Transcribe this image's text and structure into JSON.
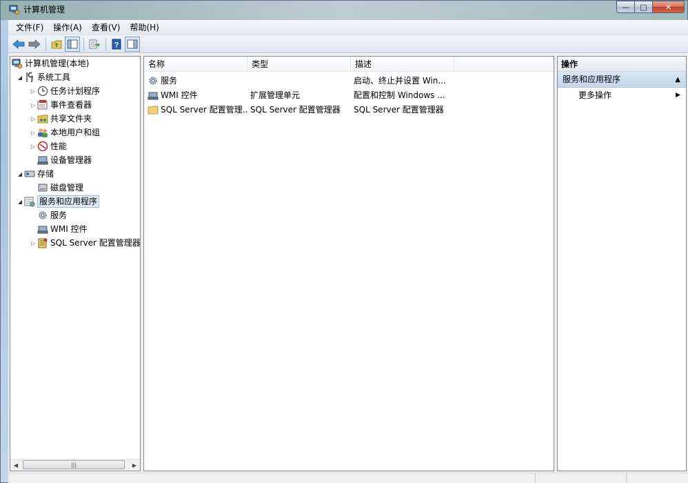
{
  "window": {
    "title": "计算机管理",
    "min_label": "—",
    "max_label": "□",
    "close_label": "✕"
  },
  "menu": [
    "文件(F)",
    "操作(A)",
    "查看(V)",
    "帮助(H)"
  ],
  "tree": {
    "root": "计算机管理(本地)",
    "system_tools": "系统工具",
    "task_scheduler": "任务计划程序",
    "event_viewer": "事件查看器",
    "shared_folders": "共享文件夹",
    "local_users": "本地用户和组",
    "performance": "性能",
    "device_manager": "设备管理器",
    "storage": "存储",
    "disk_management": "磁盘管理",
    "services_apps": "服务和应用程序",
    "services": "服务",
    "wmi": "WMI 控件",
    "sql_config": "SQL Server 配置管理器"
  },
  "scrollbar": {
    "thumb_grip": "|||"
  },
  "list": {
    "columns": [
      "名称",
      "类型",
      "描述"
    ],
    "rows": [
      {
        "name": "服务",
        "type": "",
        "desc": "启动、终止并设置 Win..."
      },
      {
        "name": "WMI 控件",
        "type": "扩展管理单元",
        "desc": "配置和控制 Windows ..."
      },
      {
        "name": "SQL Server 配置管理...",
        "type": "SQL Server 配置管理器",
        "desc": "SQL Server 配置管理器"
      }
    ]
  },
  "actions": {
    "header": "操作",
    "section": "服务和应用程序",
    "more": "更多操作"
  },
  "colors": {
    "selection": "#e0ecf8",
    "section_bg": "#c3d7ec",
    "border": "#828790"
  }
}
